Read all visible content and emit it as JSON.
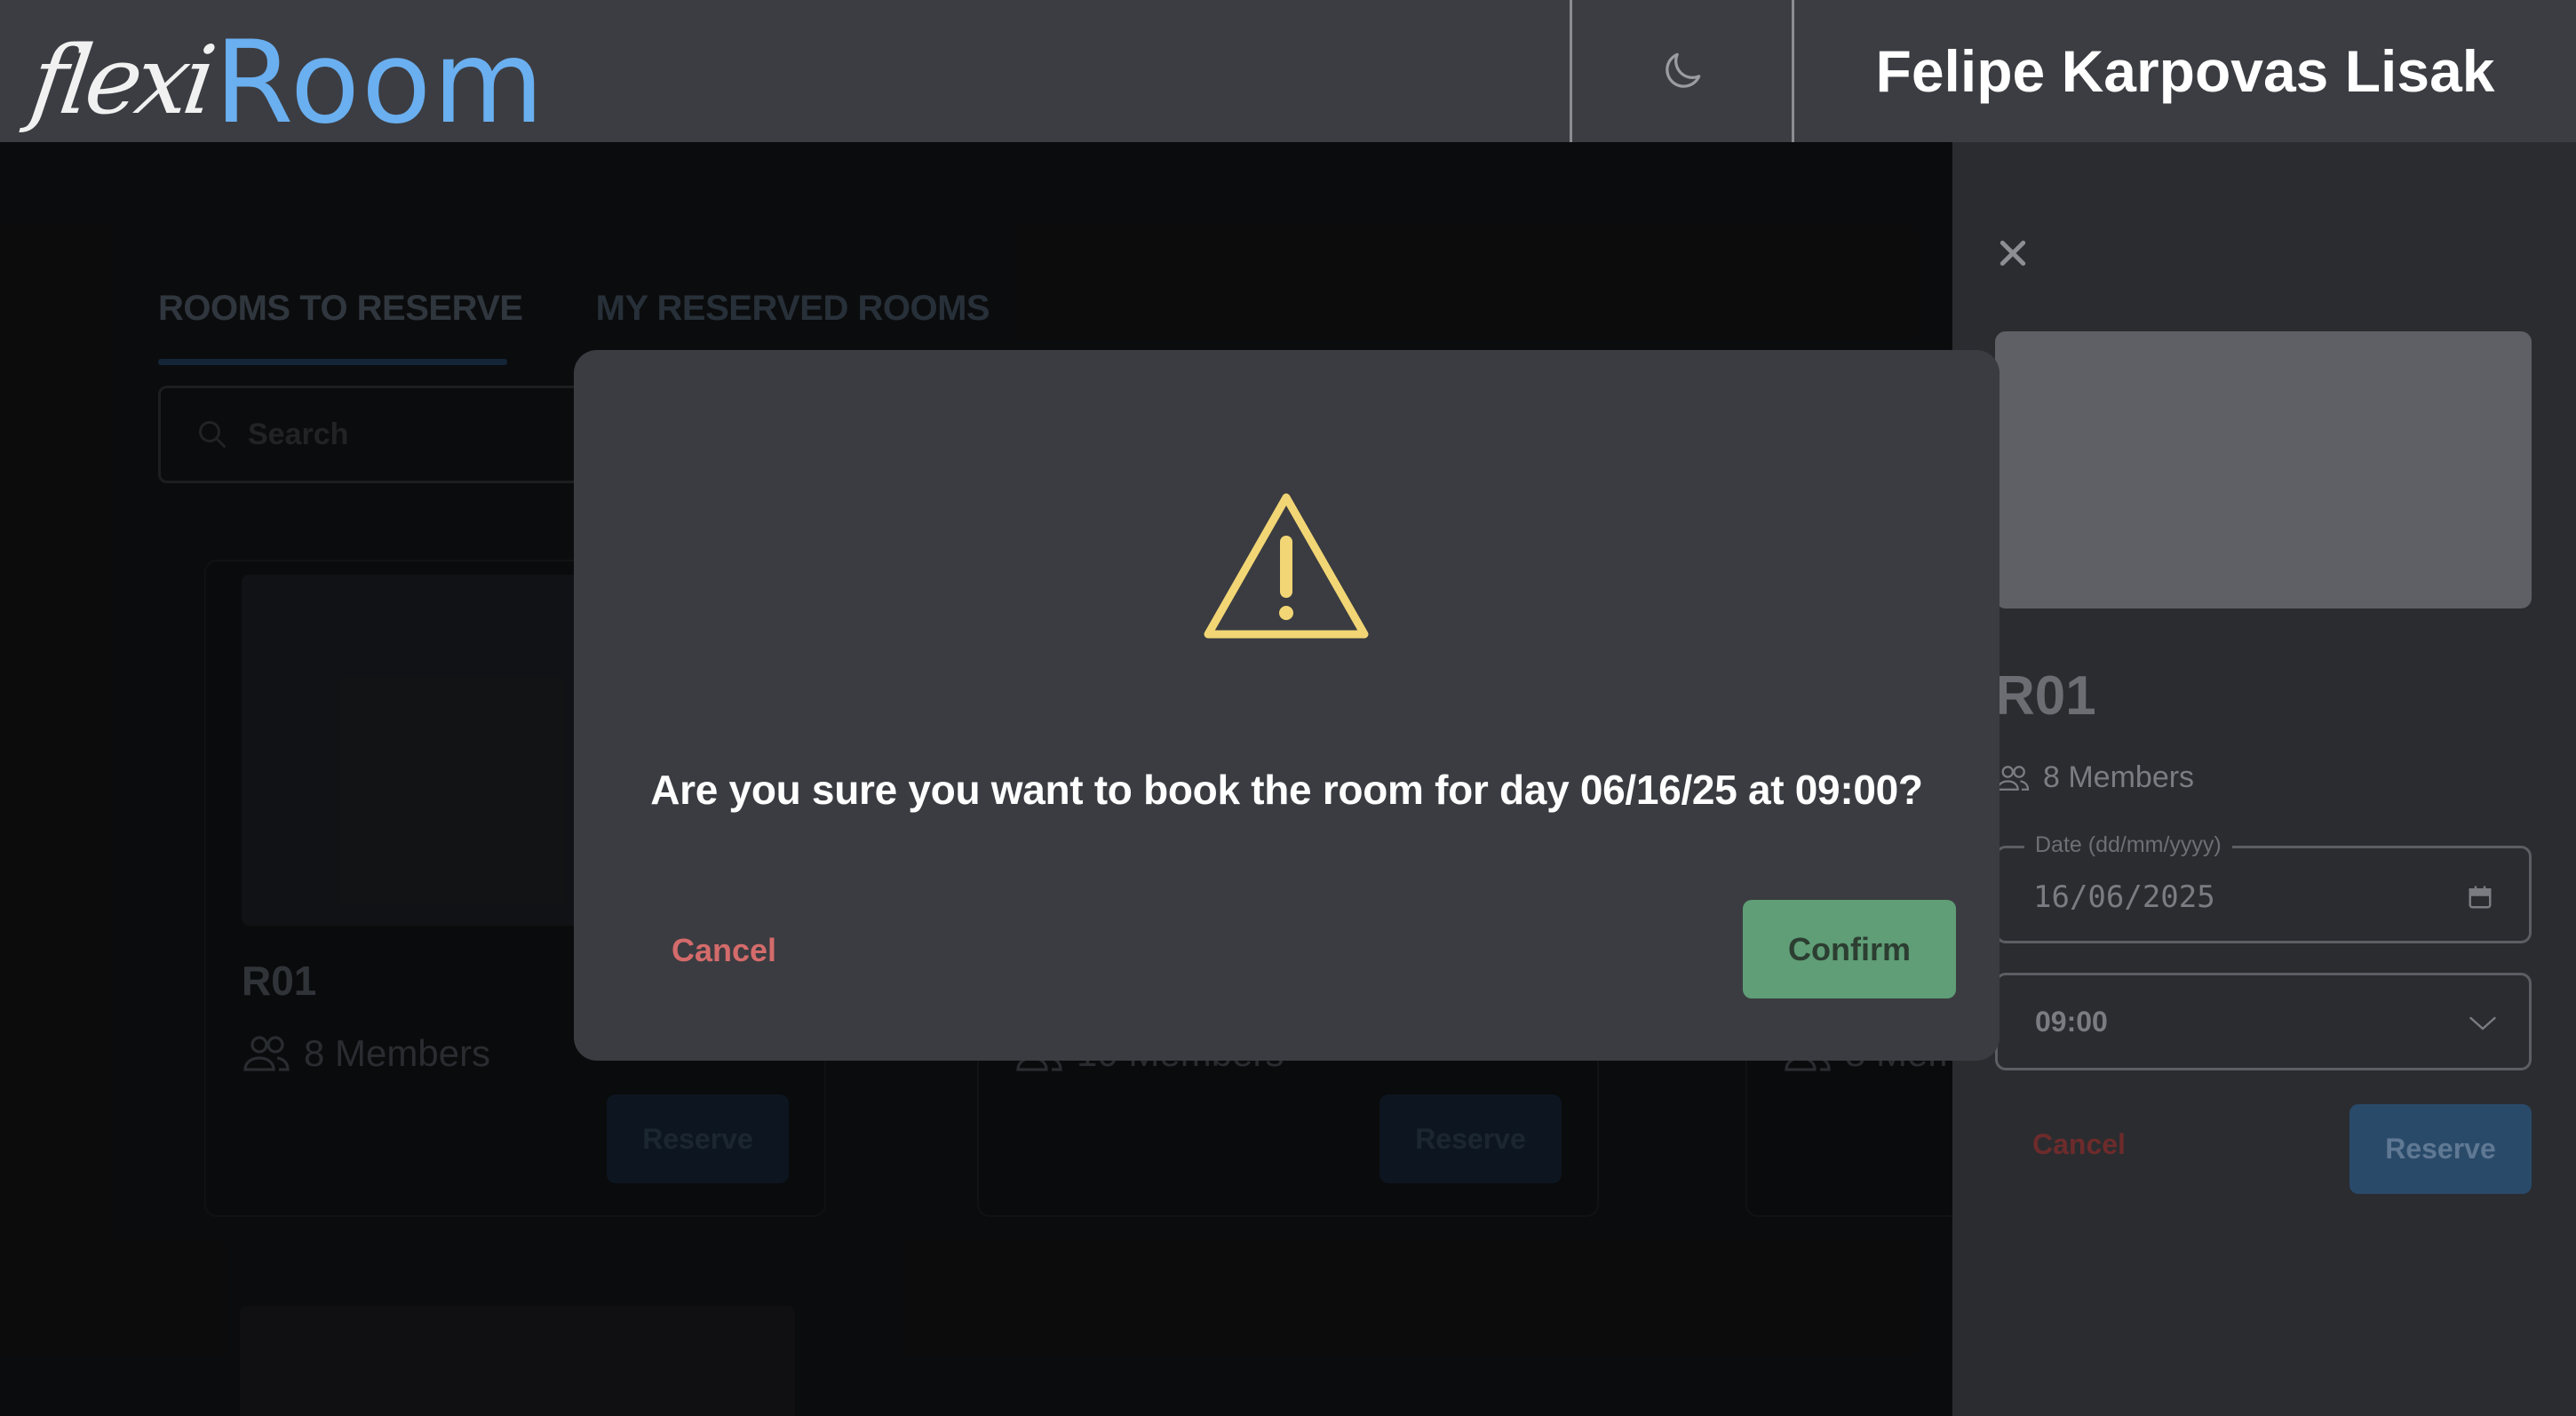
{
  "header": {
    "logo_flexi": "flexi",
    "logo_room": "Room",
    "user_name": "Felipe Karpovas Lisak"
  },
  "tabs": [
    {
      "label": "ROOMS TO RESERVE",
      "active": true
    },
    {
      "label": "MY RESERVED ROOMS",
      "active": false
    }
  ],
  "search": {
    "placeholder": "Search"
  },
  "rooms": [
    {
      "name": "R01",
      "members": "8 Members",
      "button": "Reserve"
    },
    {
      "name": "",
      "members": "10 Members",
      "button": "Reserve"
    },
    {
      "name": "",
      "members": "8 Mem",
      "button": ""
    }
  ],
  "panel": {
    "room_name": "R01",
    "members": "8 Members",
    "date_label": "Date (dd/mm/yyyy)",
    "date_value": "16/06/2025",
    "time_value": "09:00",
    "cancel_label": "Cancel",
    "reserve_label": "Reserve"
  },
  "modal": {
    "message": "Are you sure you want to book the room for day 06/16/25 at 09:00?",
    "cancel_label": "Cancel",
    "confirm_label": "Confirm"
  },
  "colors": {
    "accent": "#6aaff0",
    "warning": "#f2d675",
    "confirm": "#5f9e77",
    "danger": "#d46b6b"
  }
}
